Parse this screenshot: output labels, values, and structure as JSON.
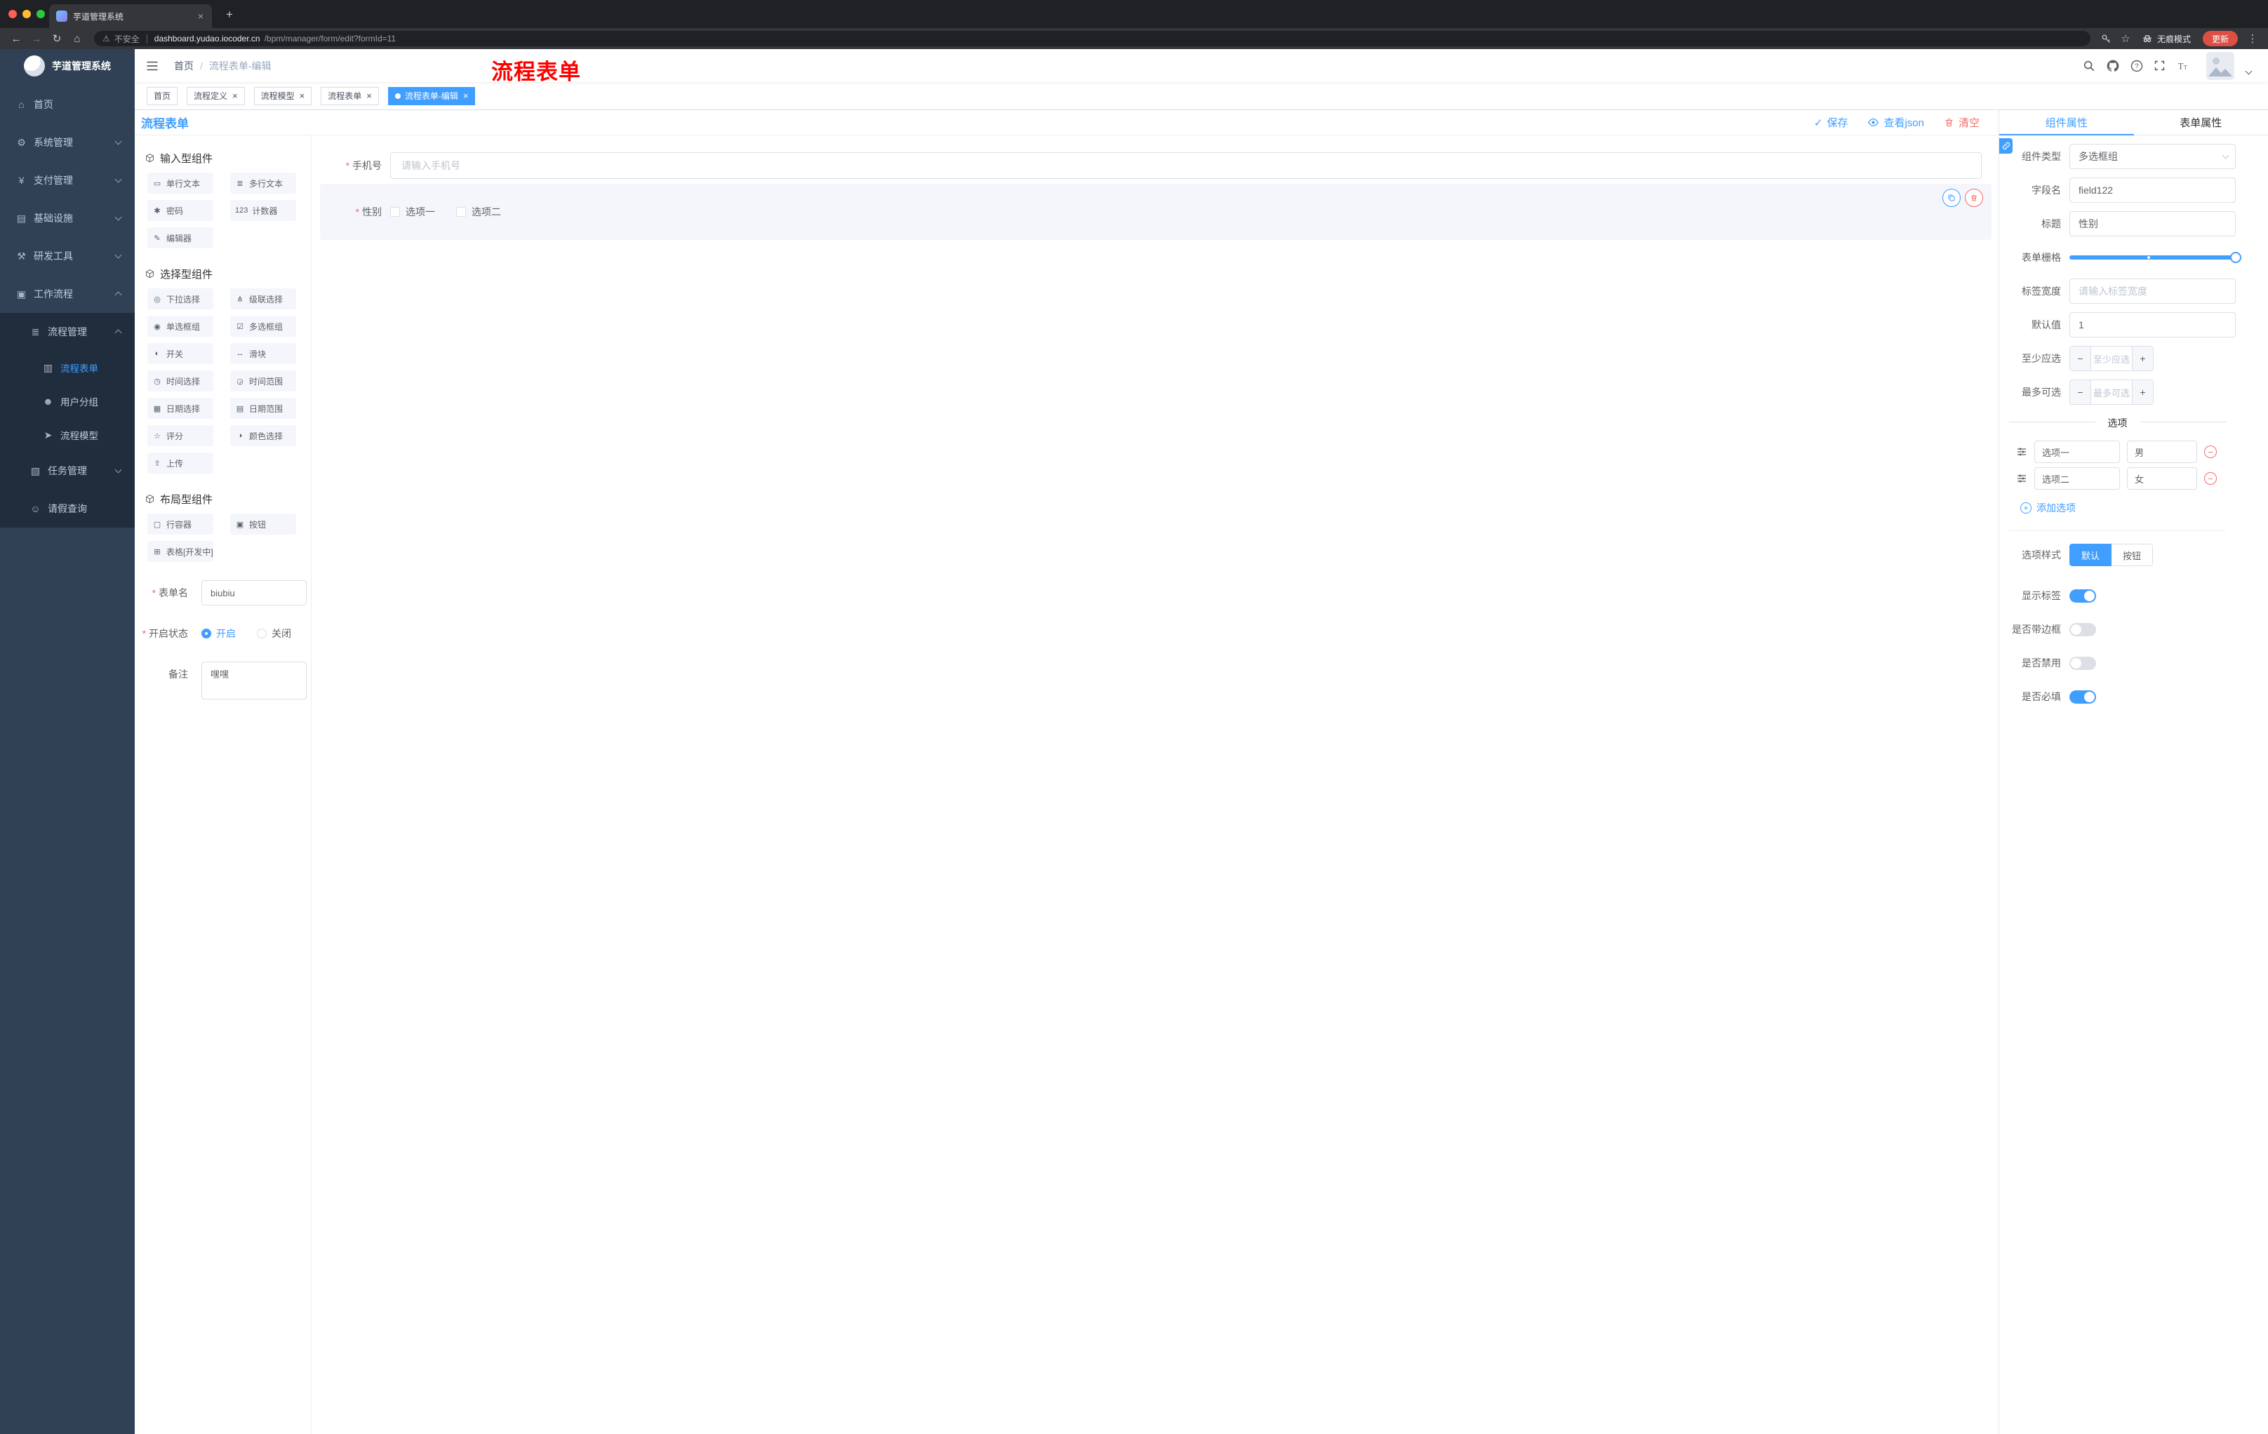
{
  "colors": {
    "accent": "#409eff",
    "danger": "#f56c6c",
    "sidebar_bg": "#304156",
    "sidebar_submenu_bg": "#1f2d3d",
    "active_tag_bg": "#409eff",
    "annotation_red": "#fe0000",
    "update_button_bg": "#dd4f43"
  },
  "icons": {
    "back": "←",
    "forward": "→",
    "reload": "↻",
    "home": "⌂",
    "star": "☆",
    "warning": "⚠",
    "menu_dots": "⋮",
    "new_tab": "+",
    "close": "×",
    "check": "✓",
    "plus": "+",
    "minus": "−"
  },
  "browser": {
    "tab_title": "芋道管理系统",
    "security_label": "不安全",
    "url_host": "dashboard.yudao.iocoder.cn",
    "url_path": "/bpm/manager/form/edit?formId=11",
    "incognito_label": "无痕模式",
    "update_label": "更新"
  },
  "sidebar": {
    "logo_title": "芋道管理系统",
    "items": [
      {
        "icon": "⌂",
        "label": "首页"
      },
      {
        "icon": "⚙",
        "label": "系统管理"
      },
      {
        "icon": "¥",
        "label": "支付管理"
      },
      {
        "icon": "▤",
        "label": "基础设施"
      },
      {
        "icon": "⚒",
        "label": "研发工具"
      },
      {
        "icon": "▣",
        "label": "工作流程"
      },
      {
        "icon": "≣",
        "label": "流程管理"
      },
      {
        "icon": "▥",
        "label": "流程表单"
      },
      {
        "icon": "☻",
        "label": "用户分组"
      },
      {
        "icon": "➤",
        "label": "流程模型"
      },
      {
        "icon": "▧",
        "label": "任务管理"
      },
      {
        "icon": "☺",
        "label": "请假查询"
      }
    ]
  },
  "navbar": {
    "breadcrumb": {
      "home": "首页",
      "separator": "/",
      "current": "流程表单-编辑"
    },
    "annotation": "流程表单"
  },
  "tags": [
    {
      "label": "首页"
    },
    {
      "label": "流程定义"
    },
    {
      "label": "流程模型"
    },
    {
      "label": "流程表单"
    },
    {
      "label": "流程表单-编辑"
    }
  ],
  "designer": {
    "title": "流程表单",
    "save_label": "保存",
    "view_json_label": "查看json",
    "clear_label": "清空",
    "palette": {
      "groups": [
        {
          "title": "输入型组件",
          "items": [
            {
              "icon": "▭",
              "label": "单行文本"
            },
            {
              "icon": "≣",
              "label": "多行文本"
            },
            {
              "icon": "✱",
              "label": "密码"
            },
            {
              "icon": "123",
              "label": "计数器"
            },
            {
              "icon": "✎",
              "label": "编辑器"
            }
          ]
        },
        {
          "title": "选择型组件",
          "items": [
            {
              "icon": "◎",
              "label": "下拉选择"
            },
            {
              "icon": "⋔",
              "label": "级联选择"
            },
            {
              "icon": "◉",
              "label": "单选框组"
            },
            {
              "icon": "☑",
              "label": "多选框组"
            },
            {
              "icon": "◐",
              "label": "开关"
            },
            {
              "icon": "↔",
              "label": "滑块"
            },
            {
              "icon": "◷",
              "label": "时间选择"
            },
            {
              "icon": "◶",
              "label": "时间范围"
            },
            {
              "icon": "▦",
              "label": "日期选择"
            },
            {
              "icon": "▤",
              "label": "日期范围"
            },
            {
              "icon": "☆",
              "label": "评分"
            },
            {
              "icon": "◑",
              "label": "颜色选择"
            },
            {
              "icon": "⇧",
              "label": "上传"
            }
          ]
        },
        {
          "title": "布局型组件",
          "items": [
            {
              "icon": "▢",
              "label": "行容器"
            },
            {
              "icon": "▣",
              "label": "按钮"
            },
            {
              "icon": "⊞",
              "label": "表格[开发中]"
            }
          ]
        }
      ]
    },
    "meta": {
      "name_label": "表单名",
      "name_value": "biubiu",
      "status_label": "开启状态",
      "status_on": "开启",
      "status_off": "关闭",
      "remark_label": "备注",
      "remark_value": "嘿嘿"
    },
    "canvas": {
      "phone": {
        "label": "手机号",
        "placeholder": "请输入手机号"
      },
      "gender": {
        "label": "性别",
        "option1": "选项一",
        "option2": "选项二"
      }
    }
  },
  "props": {
    "tab_component": "组件属性",
    "tab_form": "表单属性",
    "component_type": {
      "label": "组件类型",
      "value": "多选框组"
    },
    "field_name": {
      "label": "字段名",
      "value": "field122"
    },
    "title": {
      "label": "标题",
      "value": "性别"
    },
    "grid": {
      "label": "表单栅格"
    },
    "label_width": {
      "label": "标签宽度",
      "placeholder": "请输入标签宽度"
    },
    "default_value": {
      "label": "默认值",
      "value": "1"
    },
    "min_select": {
      "label": "至少应选",
      "placeholder": "至少应选"
    },
    "max_select": {
      "label": "最多可选",
      "placeholder": "最多可选"
    },
    "options": {
      "divider": "选项",
      "rows": [
        {
          "name": "选项一",
          "value": "男"
        },
        {
          "name": "选项二",
          "value": "女"
        }
      ],
      "add_label": "添加选项"
    },
    "option_style": {
      "label": "选项样式",
      "default": "默认",
      "button": "按钮"
    },
    "switches": [
      {
        "label": "显示标签",
        "on": true
      },
      {
        "label": "是否带边框",
        "on": false
      },
      {
        "label": "是否禁用",
        "on": false
      },
      {
        "label": "是否必填",
        "on": true
      }
    ]
  }
}
